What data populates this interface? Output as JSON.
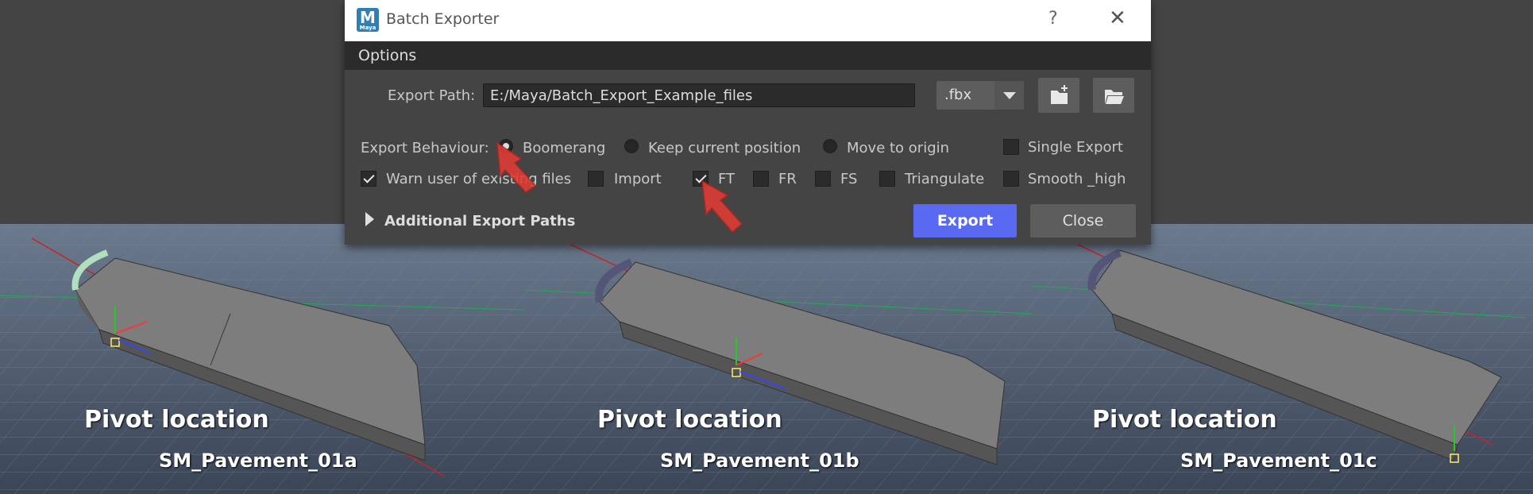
{
  "window": {
    "app_icon_letter": "M",
    "app_icon_sub": "Maya",
    "title": "Batch Exporter",
    "help_label": "?",
    "close_label": "✕"
  },
  "menu": {
    "options_label": "Options"
  },
  "export_path": {
    "label": "Export Path:",
    "value": "E:/Maya/Batch_Export_Example_files"
  },
  "format": {
    "selected": ".fbx"
  },
  "icons": {
    "new_folder": "new-folder-icon",
    "open_folder": "open-folder-icon"
  },
  "behaviour": {
    "label": "Export Behaviour:",
    "options": [
      {
        "label": "Boomerang",
        "selected": true
      },
      {
        "label": "Keep current position",
        "selected": false
      },
      {
        "label": "Move to origin",
        "selected": false
      }
    ],
    "single_export": {
      "label": "Single Export",
      "checked": false
    }
  },
  "checkboxes": [
    {
      "label": "Warn user of existing files",
      "checked": true
    },
    {
      "label": "Import",
      "checked": false
    },
    {
      "label": "FT",
      "checked": true
    },
    {
      "label": "FR",
      "checked": false
    },
    {
      "label": "FS",
      "checked": false
    },
    {
      "label": "Triangulate",
      "checked": false
    },
    {
      "label": "Smooth _high",
      "checked": false
    }
  ],
  "additional_paths": {
    "label": "Additional Export Paths"
  },
  "buttons": {
    "export": "Export",
    "close": "Close"
  },
  "captions": [
    {
      "pivot": "Pivot location",
      "name": "SM_Pavement_01a"
    },
    {
      "pivot": "Pivot location",
      "name": "SM_Pavement_01b"
    },
    {
      "pivot": "Pivot location",
      "name": "SM_Pavement_01c"
    }
  ],
  "colors": {
    "accent_button": "#5969f2",
    "annotation_arrow": "#e23b35",
    "viewport_grid": "#22aa55"
  }
}
